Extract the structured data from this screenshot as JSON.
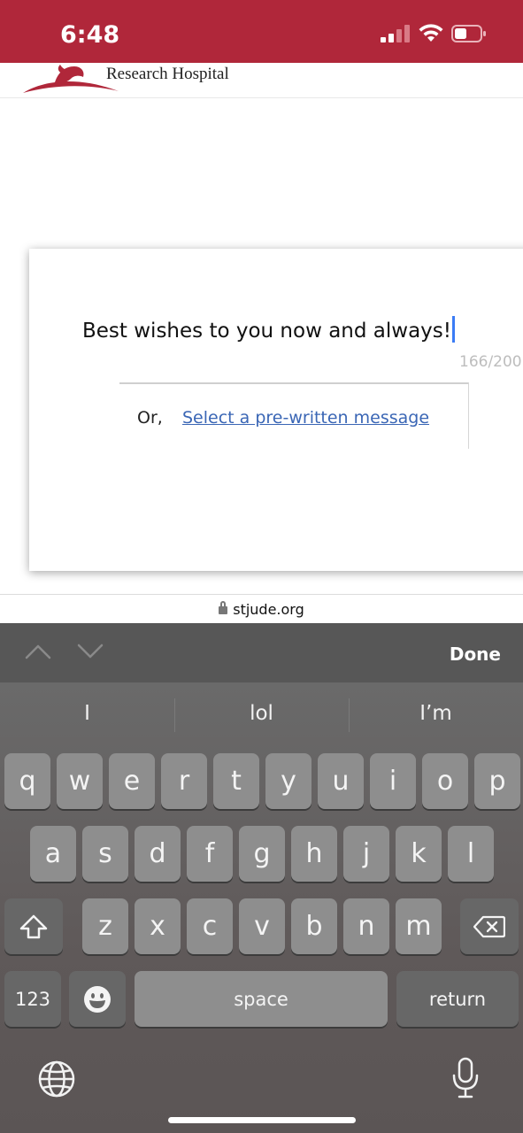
{
  "status_bar": {
    "time": "6:48",
    "icons": [
      "cellular-signal-icon",
      "wifi-icon",
      "battery-icon"
    ],
    "background": "#b0273a"
  },
  "header": {
    "logo_text": "Research Hospital",
    "brand_color": "#b0273a"
  },
  "message_card": {
    "message_text": "Best wishes to you now and always!",
    "char_counter": "166/200",
    "or_label": "Or,",
    "prewritten_link": "Select a pre-written message"
  },
  "url_bar": {
    "domain": "stjude.org"
  },
  "keyboard_accessory": {
    "done_label": "Done",
    "icons": [
      "chevron-up-icon",
      "chevron-down-icon"
    ]
  },
  "keyboard": {
    "suggestions": [
      "I",
      "lol",
      "I’m"
    ],
    "row1": [
      "q",
      "w",
      "e",
      "r",
      "t",
      "y",
      "u",
      "i",
      "o",
      "p"
    ],
    "row2": [
      "a",
      "s",
      "d",
      "f",
      "g",
      "h",
      "j",
      "k",
      "l"
    ],
    "row3": [
      "z",
      "x",
      "c",
      "v",
      "b",
      "n",
      "m"
    ],
    "numbers_label": "123",
    "space_label": "space",
    "return_label": "return",
    "icons": [
      "shift-icon",
      "delete-icon",
      "emoji-icon",
      "globe-icon",
      "microphone-icon"
    ]
  }
}
